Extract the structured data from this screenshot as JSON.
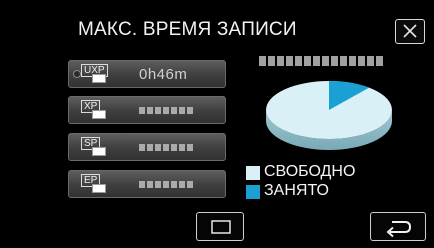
{
  "header": {
    "title": "МАКС. ВРЕМЯ ЗАПИСИ",
    "close_icon": "close-icon"
  },
  "modes": [
    {
      "label": "UXP",
      "value": "0h46m",
      "selected": true
    },
    {
      "label": "XP",
      "value": "",
      "selected": false
    },
    {
      "label": "SP",
      "value": "",
      "selected": false
    },
    {
      "label": "EP",
      "value": "",
      "selected": false
    }
  ],
  "legend": {
    "free_label": "СВОБОДНО",
    "used_label": "ЗАНЯТО",
    "free_color": "#d9f0f6",
    "used_color": "#1aa0d2"
  },
  "usage": {
    "used_fraction": 0.11
  },
  "bottom": {
    "left_icon": "frame-icon",
    "right_icon": "return-arrow-icon"
  }
}
